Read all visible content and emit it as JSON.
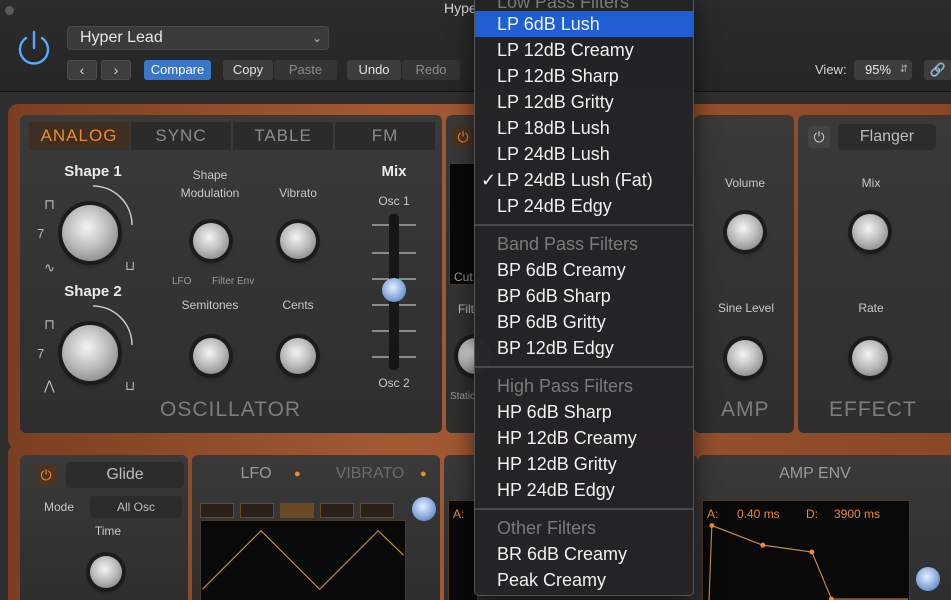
{
  "window": {
    "title": "Hype"
  },
  "toolbar": {
    "preset": "Hyper Lead",
    "prev_label": "‹",
    "next_label": "›",
    "compare": "Compare",
    "copy": "Copy",
    "paste": "Paste",
    "undo": "Undo",
    "redo": "Redo",
    "view_label": "View:",
    "view_value": "95%"
  },
  "oscillator": {
    "tabs": [
      "ANALOG",
      "SYNC",
      "TABLE",
      "FM"
    ],
    "active_tab": "ANALOG",
    "shape1": "Shape 1",
    "shape2": "Shape 2",
    "shape_mod": "Shape\nModulation",
    "shape_mod_line1": "Shape",
    "shape_mod_line2": "Modulation",
    "lfo": "LFO",
    "filter_env": "Filter Env",
    "vibrato": "Vibrato",
    "semitones": "Semitones",
    "cents": "Cents",
    "mix": "Mix",
    "osc1": "Osc 1",
    "osc2": "Osc 2",
    "section": "OSCILLATOR"
  },
  "filter": {
    "cut_label": "Cut",
    "filt_label": "Filt",
    "static_label": "Static"
  },
  "amp": {
    "volume": "Volume",
    "sine_level": "Sine Level",
    "section": "AMP"
  },
  "effect": {
    "name": "Flanger",
    "mix": "Mix",
    "rate": "Rate",
    "section": "EFFECT"
  },
  "bottom": {
    "glide": "Glide",
    "mode_label": "Mode",
    "mode_value": "All Osc",
    "time": "Time",
    "lfo_tab": "LFO",
    "vibrato_tab": "VIBRATO",
    "amp_env": "AMP ENV",
    "env_a_label": "A:",
    "env_a_value": "0.40 ms",
    "env_d_label": "D:",
    "env_d_value": "3900 ms",
    "filter_env_a": "A:"
  },
  "menu": {
    "top_header": "Low Pass Filters",
    "low_pass": [
      "LP 6dB Lush",
      "LP 12dB Creamy",
      "LP 12dB Sharp",
      "LP 12dB Gritty",
      "LP 18dB Lush",
      "LP 24dB Lush",
      "LP 24dB Lush (Fat)",
      "LP 24dB Edgy"
    ],
    "selected_index": 0,
    "checked_index": 6,
    "check_mark": "✓",
    "band_pass_header": "Band Pass Filters",
    "band_pass": [
      "BP 6dB Creamy",
      "BP 6dB Sharp",
      "BP 6dB Gritty",
      "BP 12dB Edgy"
    ],
    "high_pass_header": "High Pass Filters",
    "high_pass": [
      "HP 6dB Sharp",
      "HP 12dB Creamy",
      "HP 12dB Gritty",
      "HP 24dB Edgy"
    ],
    "other_header": "Other Filters",
    "other": [
      "BR 6dB Creamy",
      "Peak Creamy"
    ]
  },
  "colors": {
    "accent": "#ef8a2f",
    "selection": "#1f5fd3",
    "compare": "#3a76c7"
  },
  "icons": {
    "power": "power-icon",
    "link": "link-icon",
    "checkmark": "checkmark-icon"
  }
}
